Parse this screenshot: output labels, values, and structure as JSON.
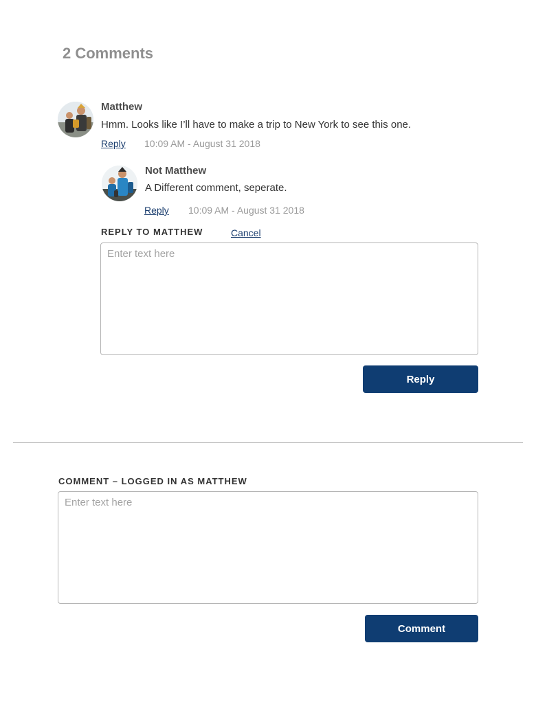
{
  "comments_section": {
    "heading": "2 Comments"
  },
  "comments": [
    {
      "author": "Matthew",
      "text": "Hmm. Looks like I’ll have to make a trip to New York to see this one.",
      "reply_label": "Reply",
      "timestamp": "10:09 AM - August 31 2018",
      "avatar_icon": "user-photo-avatar"
    }
  ],
  "replies": [
    {
      "author": "Not Matthew",
      "text": "A Different comment, seperate.",
      "reply_label": "Reply",
      "timestamp": "10:09 AM - August 31 2018",
      "avatar_icon": "user-photo-avatar"
    }
  ],
  "reply_form": {
    "label": "REPLY TO MATTHEW",
    "cancel_label": "Cancel",
    "placeholder": "Enter text here",
    "value": "",
    "submit_label": "Reply"
  },
  "comment_form": {
    "label": "COMMENT – LOGGED IN AS MATTHEW",
    "placeholder": "Enter text here",
    "value": "",
    "submit_label": "Comment"
  },
  "colors": {
    "primary_button": "#0f3d72",
    "link": "#1a3d6e",
    "heading": "#8f8f8f",
    "timestamp": "#9a9a9a"
  }
}
